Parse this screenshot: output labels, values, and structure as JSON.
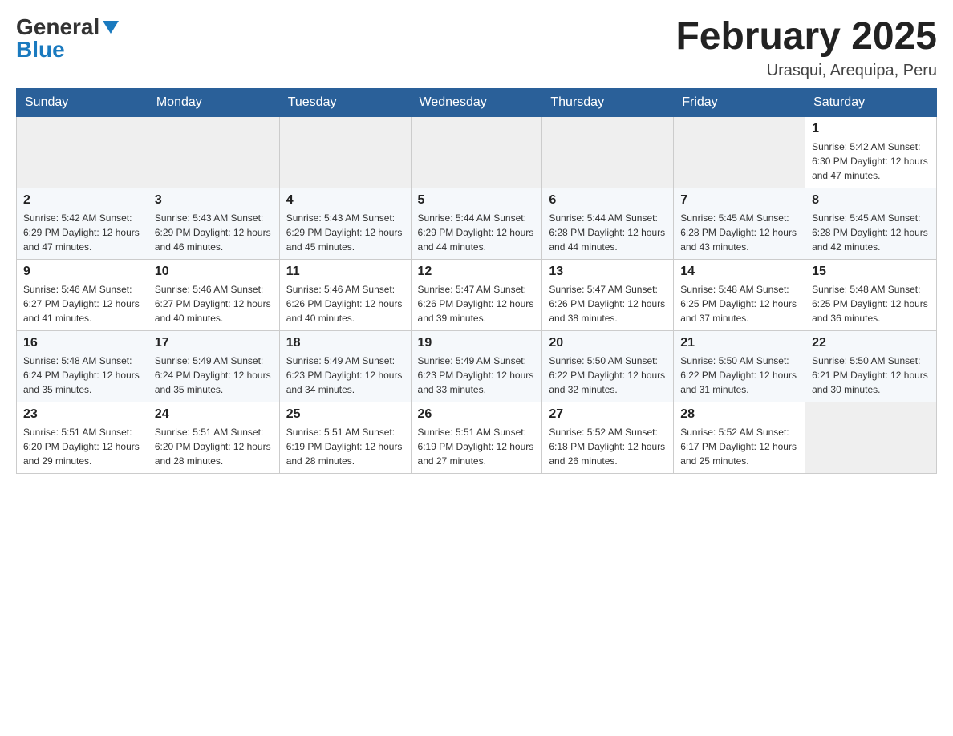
{
  "header": {
    "logo_general": "General",
    "logo_blue": "Blue",
    "month_title": "February 2025",
    "location": "Urasqui, Arequipa, Peru"
  },
  "days_of_week": [
    "Sunday",
    "Monday",
    "Tuesday",
    "Wednesday",
    "Thursday",
    "Friday",
    "Saturday"
  ],
  "weeks": [
    [
      {
        "day": "",
        "info": ""
      },
      {
        "day": "",
        "info": ""
      },
      {
        "day": "",
        "info": ""
      },
      {
        "day": "",
        "info": ""
      },
      {
        "day": "",
        "info": ""
      },
      {
        "day": "",
        "info": ""
      },
      {
        "day": "1",
        "info": "Sunrise: 5:42 AM\nSunset: 6:30 PM\nDaylight: 12 hours and 47 minutes."
      }
    ],
    [
      {
        "day": "2",
        "info": "Sunrise: 5:42 AM\nSunset: 6:29 PM\nDaylight: 12 hours and 47 minutes."
      },
      {
        "day": "3",
        "info": "Sunrise: 5:43 AM\nSunset: 6:29 PM\nDaylight: 12 hours and 46 minutes."
      },
      {
        "day": "4",
        "info": "Sunrise: 5:43 AM\nSunset: 6:29 PM\nDaylight: 12 hours and 45 minutes."
      },
      {
        "day": "5",
        "info": "Sunrise: 5:44 AM\nSunset: 6:29 PM\nDaylight: 12 hours and 44 minutes."
      },
      {
        "day": "6",
        "info": "Sunrise: 5:44 AM\nSunset: 6:28 PM\nDaylight: 12 hours and 44 minutes."
      },
      {
        "day": "7",
        "info": "Sunrise: 5:45 AM\nSunset: 6:28 PM\nDaylight: 12 hours and 43 minutes."
      },
      {
        "day": "8",
        "info": "Sunrise: 5:45 AM\nSunset: 6:28 PM\nDaylight: 12 hours and 42 minutes."
      }
    ],
    [
      {
        "day": "9",
        "info": "Sunrise: 5:46 AM\nSunset: 6:27 PM\nDaylight: 12 hours and 41 minutes."
      },
      {
        "day": "10",
        "info": "Sunrise: 5:46 AM\nSunset: 6:27 PM\nDaylight: 12 hours and 40 minutes."
      },
      {
        "day": "11",
        "info": "Sunrise: 5:46 AM\nSunset: 6:26 PM\nDaylight: 12 hours and 40 minutes."
      },
      {
        "day": "12",
        "info": "Sunrise: 5:47 AM\nSunset: 6:26 PM\nDaylight: 12 hours and 39 minutes."
      },
      {
        "day": "13",
        "info": "Sunrise: 5:47 AM\nSunset: 6:26 PM\nDaylight: 12 hours and 38 minutes."
      },
      {
        "day": "14",
        "info": "Sunrise: 5:48 AM\nSunset: 6:25 PM\nDaylight: 12 hours and 37 minutes."
      },
      {
        "day": "15",
        "info": "Sunrise: 5:48 AM\nSunset: 6:25 PM\nDaylight: 12 hours and 36 minutes."
      }
    ],
    [
      {
        "day": "16",
        "info": "Sunrise: 5:48 AM\nSunset: 6:24 PM\nDaylight: 12 hours and 35 minutes."
      },
      {
        "day": "17",
        "info": "Sunrise: 5:49 AM\nSunset: 6:24 PM\nDaylight: 12 hours and 35 minutes."
      },
      {
        "day": "18",
        "info": "Sunrise: 5:49 AM\nSunset: 6:23 PM\nDaylight: 12 hours and 34 minutes."
      },
      {
        "day": "19",
        "info": "Sunrise: 5:49 AM\nSunset: 6:23 PM\nDaylight: 12 hours and 33 minutes."
      },
      {
        "day": "20",
        "info": "Sunrise: 5:50 AM\nSunset: 6:22 PM\nDaylight: 12 hours and 32 minutes."
      },
      {
        "day": "21",
        "info": "Sunrise: 5:50 AM\nSunset: 6:22 PM\nDaylight: 12 hours and 31 minutes."
      },
      {
        "day": "22",
        "info": "Sunrise: 5:50 AM\nSunset: 6:21 PM\nDaylight: 12 hours and 30 minutes."
      }
    ],
    [
      {
        "day": "23",
        "info": "Sunrise: 5:51 AM\nSunset: 6:20 PM\nDaylight: 12 hours and 29 minutes."
      },
      {
        "day": "24",
        "info": "Sunrise: 5:51 AM\nSunset: 6:20 PM\nDaylight: 12 hours and 28 minutes."
      },
      {
        "day": "25",
        "info": "Sunrise: 5:51 AM\nSunset: 6:19 PM\nDaylight: 12 hours and 28 minutes."
      },
      {
        "day": "26",
        "info": "Sunrise: 5:51 AM\nSunset: 6:19 PM\nDaylight: 12 hours and 27 minutes."
      },
      {
        "day": "27",
        "info": "Sunrise: 5:52 AM\nSunset: 6:18 PM\nDaylight: 12 hours and 26 minutes."
      },
      {
        "day": "28",
        "info": "Sunrise: 5:52 AM\nSunset: 6:17 PM\nDaylight: 12 hours and 25 minutes."
      },
      {
        "day": "",
        "info": ""
      }
    ]
  ]
}
